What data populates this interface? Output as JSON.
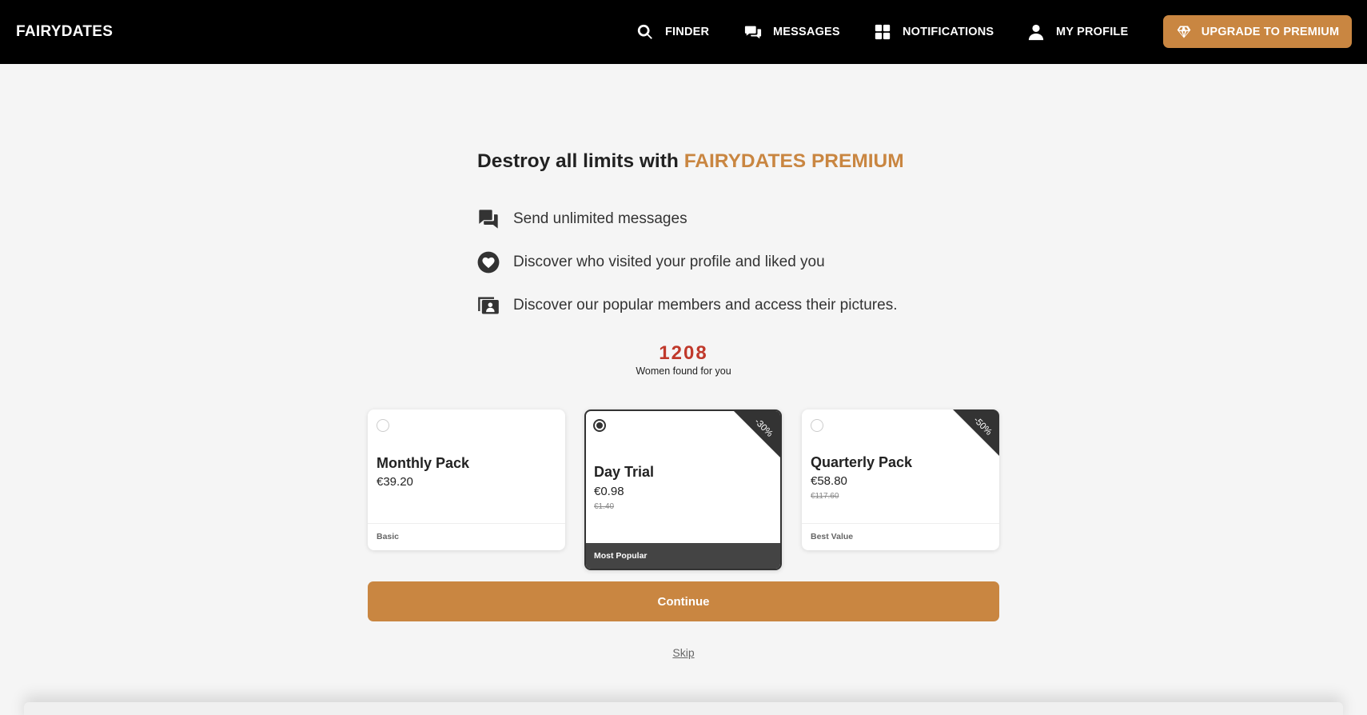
{
  "header": {
    "logo": "FAIRYDATES",
    "nav": [
      {
        "label": "FINDER",
        "icon": "search-icon"
      },
      {
        "label": "MESSAGES",
        "icon": "chat-icon"
      },
      {
        "label": "NOTIFICATIONS",
        "icon": "grid-icon"
      },
      {
        "label": "MY PROFILE",
        "icon": "user-icon"
      }
    ],
    "upgrade": {
      "label": "UPGRADE TO PREMIUM",
      "icon": "diamond-icon"
    }
  },
  "main": {
    "headline_prefix": "Destroy all limits with ",
    "headline_brand": "FAIRYDATES PREMIUM",
    "features": [
      {
        "text": "Send unlimited messages",
        "icon": "chat-bubbles-icon"
      },
      {
        "text": "Discover who visited your profile and liked you",
        "icon": "heart-icon"
      },
      {
        "text": "Discover our popular members and access their pictures.",
        "icon": "member-photos-icon"
      }
    ],
    "count": "1208",
    "count_label": "Women found for you",
    "plans": [
      {
        "name": "Monthly Pack",
        "price": "€39.20",
        "old_price": "",
        "footer": "Basic",
        "badge": "",
        "selected": false
      },
      {
        "name": "Day Trial",
        "price": "€0.98",
        "old_price": "€1.40",
        "footer": "Most Popular",
        "badge": "-30%",
        "selected": true
      },
      {
        "name": "Quarterly Pack",
        "price": "€58.80",
        "old_price": "€117.60",
        "footer": "Best Value",
        "badge": "-50%",
        "selected": false
      }
    ],
    "continue_label": "Continue",
    "skip_label": "Skip"
  },
  "colors": {
    "accent": "#c98641",
    "count": "#c0392b",
    "header_bg": "#000000",
    "selected_footer": "#444444"
  }
}
